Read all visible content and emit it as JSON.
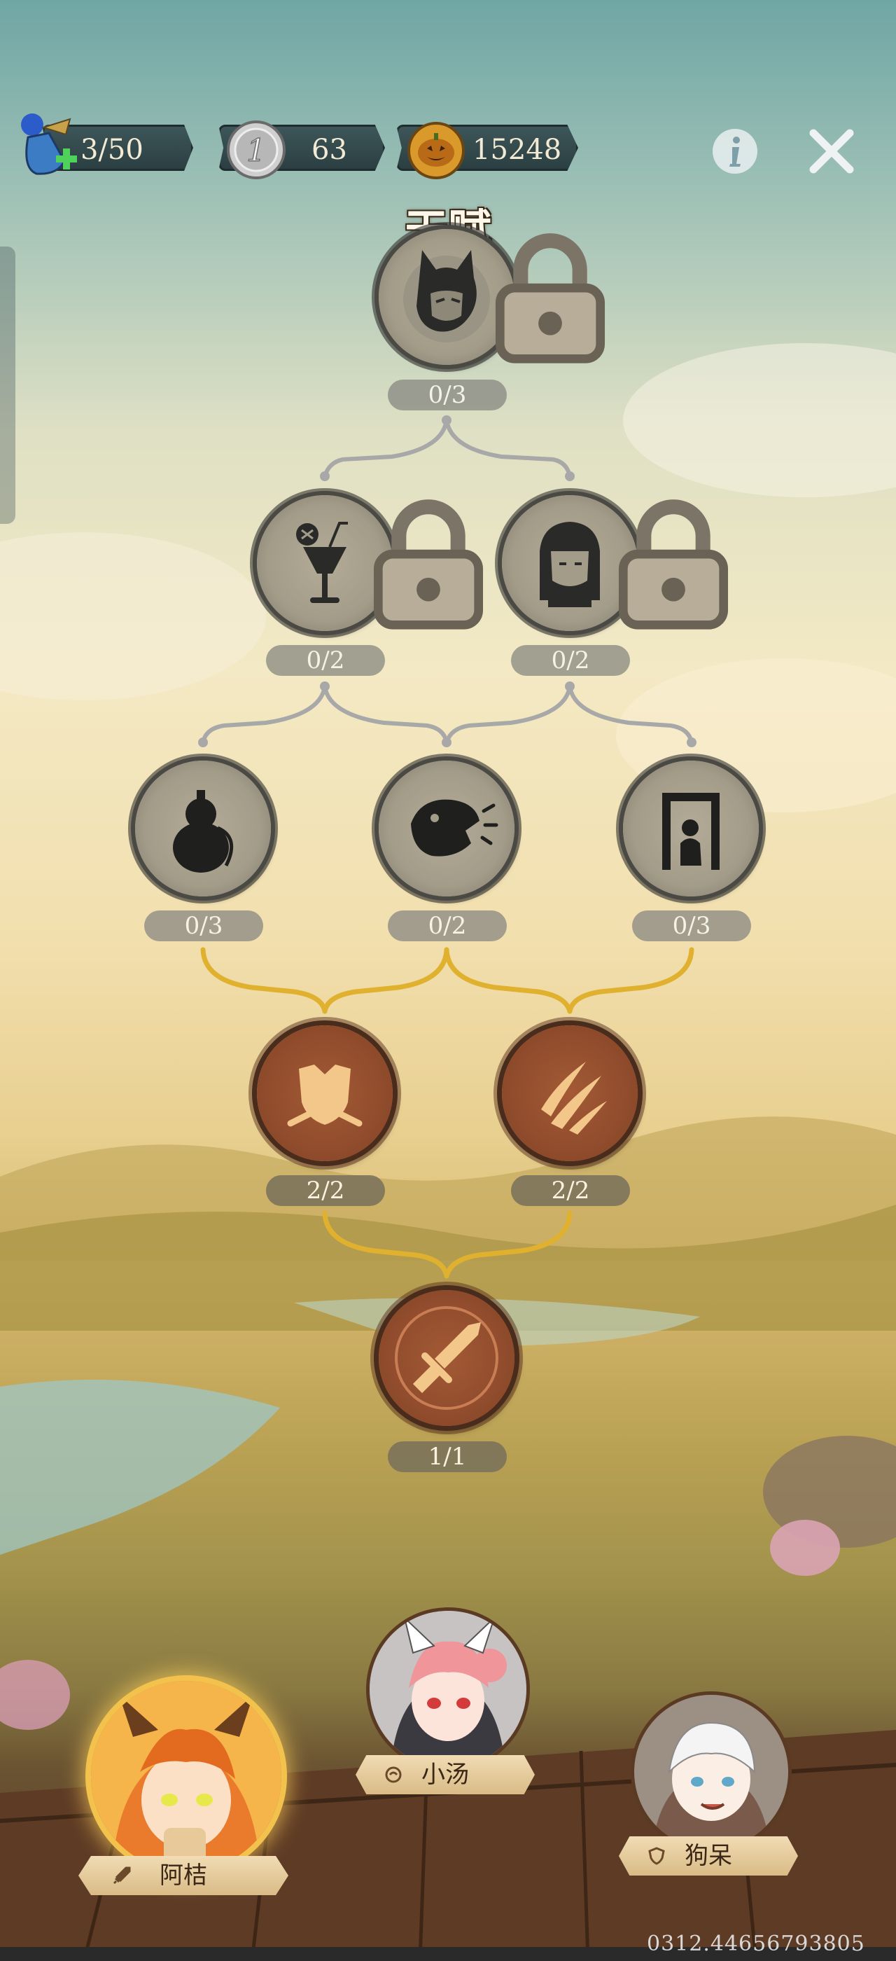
{
  "hud": {
    "stamina": {
      "value": "3/50",
      "icon": "stamina-potion-icon"
    },
    "silver_coin": {
      "value": "63",
      "icon": "silver-coin-icon"
    },
    "pumpkin_coin": {
      "value": "15248",
      "icon": "pumpkin-coin-icon"
    },
    "info_icon": "info-icon",
    "close_icon": "close-icon"
  },
  "title": "天赋",
  "talents": {
    "tier1": [
      {
        "count": "0/3",
        "icon": "cat-girl-portrait-icon",
        "locked": true
      }
    ],
    "tier2": [
      {
        "count": "0/2",
        "icon": "cocktail-glass-icon",
        "locked": true
      },
      {
        "count": "0/2",
        "icon": "girl-portrait-icon",
        "locked": true
      }
    ],
    "tier3": [
      {
        "count": "0/3",
        "icon": "gourd-icon",
        "locked": false
      },
      {
        "count": "0/2",
        "icon": "beast-head-icon",
        "locked": false
      },
      {
        "count": "0/3",
        "icon": "doorway-figure-icon",
        "locked": false
      }
    ],
    "tier4": [
      {
        "count": "2/2",
        "icon": "shield-icon",
        "active": true
      },
      {
        "count": "2/2",
        "icon": "claw-marks-icon",
        "active": true
      }
    ],
    "tier5": [
      {
        "count": "1/1",
        "icon": "sword-icon",
        "active": true
      }
    ]
  },
  "characters": [
    {
      "name": "阿桔",
      "role_icon": "sword-icon",
      "selected": true
    },
    {
      "name": "小汤",
      "role_icon": "heal-icon",
      "selected": false
    },
    {
      "name": "狗呆",
      "role_icon": "shield-icon",
      "selected": false
    }
  ],
  "footer_number": "0312.44656793805",
  "colors": {
    "active_node": "#8d4a2b",
    "locked_node": "#a39c89",
    "gold_line": "#e0b12e",
    "grey_line": "#a8a8a8"
  }
}
